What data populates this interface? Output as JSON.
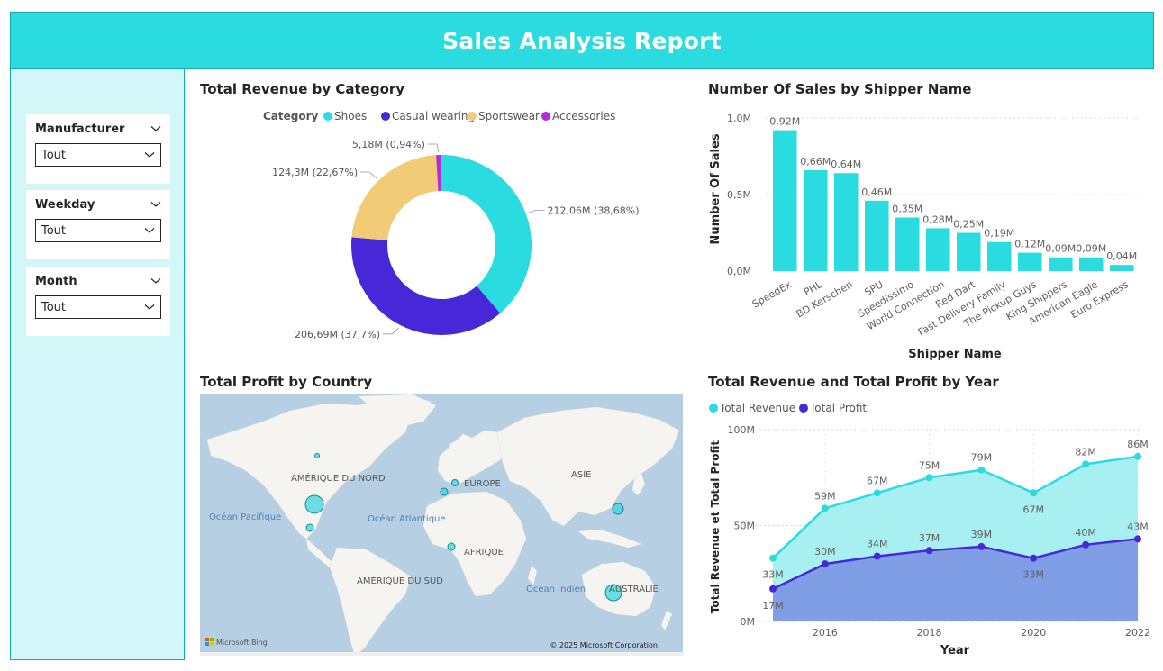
{
  "header": {
    "title": "Sales Analysis Report"
  },
  "slicers": [
    {
      "title": "Manufacturer",
      "value": "Tout"
    },
    {
      "title": "Weekday",
      "value": "Tout"
    },
    {
      "title": "Month",
      "value": "Tout"
    }
  ],
  "colors": {
    "header": "#2adbe0",
    "sidebar": "#d3f6f8",
    "shoes": "#2adbe0",
    "casual": "#4628d9",
    "sportswear": "#f2cb76",
    "accessories": "#b32ddc",
    "revenue": "#2adbe0",
    "profit": "#4628d9",
    "ocean": "#b7cfe2",
    "land": "#f5f4f1"
  },
  "donut": {
    "title": "Total Revenue by Category",
    "legend_title": "Category",
    "chart_data": {
      "type": "pie",
      "categories": [
        "Shoes",
        "Casual wearing",
        "Sportswear",
        "Accessories"
      ],
      "values": [
        212.06,
        206.69,
        124.3,
        5.18
      ],
      "unit": "M",
      "labels": [
        "212,06M (38,68%)",
        "206,69M (37,7%)",
        "124,3M (22,67%)",
        "5,18M (0,94%)"
      ]
    }
  },
  "bar": {
    "title": "Number Of Sales by Shipper Name",
    "chart_data": {
      "type": "bar",
      "categories": [
        "SpeedEx",
        "PHL",
        "BD Kerschen",
        "SPU",
        "Speedissimo",
        "World Connection",
        "Red Dart",
        "Fast Delivery Family",
        "The Pickup Guys",
        "King Shippers",
        "American Eagle",
        "Euro Express"
      ],
      "values": [
        0.92,
        0.66,
        0.64,
        0.46,
        0.35,
        0.28,
        0.25,
        0.19,
        0.12,
        0.09,
        0.09,
        0.04
      ],
      "data_labels": [
        "0,92M",
        "0,66M",
        "0,64M",
        "0,46M",
        "0,35M",
        "0,28M",
        "0,25M",
        "0,19M",
        "0,12M",
        "0,09M",
        "0,09M",
        "0,04M"
      ],
      "xlabel": "Shipper Name",
      "ylabel": "Number Of Sales",
      "ylim": [
        0,
        1.0
      ],
      "yticks": [
        0,
        0.5,
        1.0
      ],
      "ytick_labels": [
        "0,0M",
        "0,5M",
        "1,0M"
      ],
      "grid": true
    }
  },
  "map": {
    "title": "Total Profit by Country",
    "labels": {
      "na": "AMÉRIQUE DU NORD",
      "sa": "AMÉRIQUE DU SUD",
      "eu": "EUROPE",
      "asia": "ASIE",
      "af": "AFRIQUE",
      "au": "AUSTRALIE",
      "pacific": "Océan Pacifique",
      "atlantic": "Océan Atlantique",
      "indian": "Océan Indien"
    },
    "brand": "Microsoft Bing",
    "copyright": "© 2025 Microsoft Corporation"
  },
  "line": {
    "title": "Total Revenue and Total Profit by Year",
    "chart_data": {
      "type": "area",
      "x": [
        2015,
        2016,
        2017,
        2018,
        2019,
        2020,
        2021,
        2022
      ],
      "series": [
        {
          "name": "Total Revenue",
          "values": [
            33,
            59,
            67,
            75,
            79,
            67,
            82,
            86
          ],
          "labels": [
            "33M",
            "59M",
            "67M",
            "75M",
            "79M",
            "67M",
            "82M",
            "86M"
          ]
        },
        {
          "name": "Total Profit",
          "values": [
            17,
            30,
            34,
            37,
            39,
            33,
            40,
            43
          ],
          "labels": [
            "17M",
            "30M",
            "34M",
            "37M",
            "39M",
            "33M",
            "40M",
            "43M"
          ]
        }
      ],
      "xlabel": "Year",
      "ylabel": "Total Revenue et Total Profit",
      "xticks": [
        "2016",
        "2018",
        "2020",
        "2022"
      ],
      "ylim": [
        0,
        100
      ],
      "ytick_labels": [
        "0M",
        "50M",
        "100M"
      ],
      "grid": true
    }
  }
}
